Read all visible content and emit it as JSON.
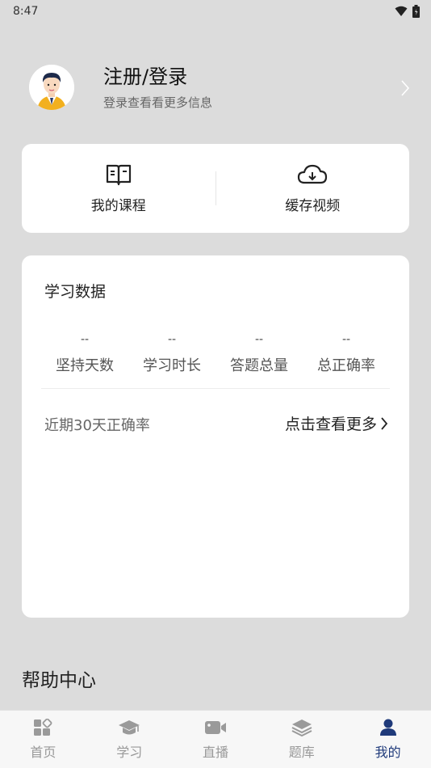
{
  "status_bar": {
    "time": "8:47"
  },
  "profile": {
    "name": "注册/登录",
    "subtitle": "登录查看看更多信息"
  },
  "quick_actions": [
    {
      "label": "我的课程",
      "icon": "book-icon"
    },
    {
      "label": "缓存视频",
      "icon": "cloud-download-icon"
    }
  ],
  "study_data": {
    "title": "学习数据",
    "stats": [
      {
        "value": "--",
        "label": "坚持天数"
      },
      {
        "value": "--",
        "label": "学习时长"
      },
      {
        "value": "--",
        "label": "答题总量"
      },
      {
        "value": "--",
        "label": "总正确率"
      }
    ],
    "recent_label": "近期30天正确率",
    "more_label": "点击查看更多"
  },
  "help": {
    "title": "帮助中心"
  },
  "tabbar": {
    "tabs": [
      {
        "label": "首页",
        "icon": "home-grid-icon",
        "active": false
      },
      {
        "label": "学习",
        "icon": "graduation-cap-icon",
        "active": false
      },
      {
        "label": "直播",
        "icon": "video-camera-icon",
        "active": false
      },
      {
        "label": "题库",
        "icon": "layers-icon",
        "active": false
      },
      {
        "label": "我的",
        "icon": "person-icon",
        "active": true
      }
    ]
  },
  "colors": {
    "background": "#dcdcdc",
    "card": "#ffffff",
    "active_tab": "#1f3a7a",
    "inactive_tab": "#999999"
  }
}
